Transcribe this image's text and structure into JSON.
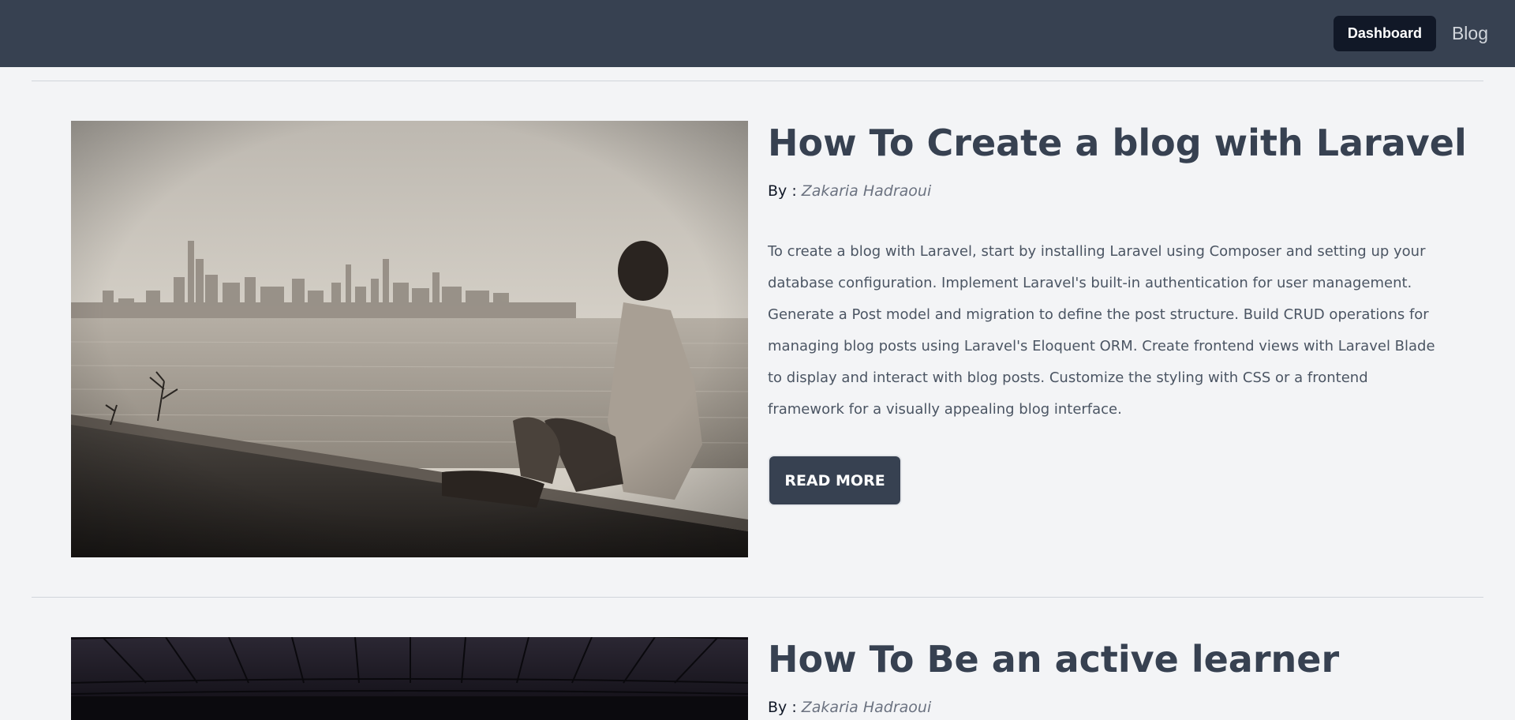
{
  "nav": {
    "dashboard_label": "Dashboard",
    "blog_label": "Blog"
  },
  "posts": [
    {
      "title": "How To Create a blog with Laravel",
      "by_prefix": "By : ",
      "author": "Zakaria Hadraoui",
      "excerpt": "To create a blog with Laravel, start by installing Laravel using Composer and setting up your database configuration. Implement Laravel's built-in authentication for user management. Generate a Post model and migration to define the post structure. Build CRUD operations for managing blog posts using Laravel's Eloquent ORM. Create frontend views with Laravel Blade to display and interact with blog posts. Customize the styling with CSS or a frontend framework for a visually appealing blog interface.",
      "read_more_label": "READ MORE"
    },
    {
      "title": "How To Be an active learner",
      "by_prefix": "By : ",
      "author": "Zakaria Hadraoui"
    }
  ],
  "colors": {
    "topbar": "#374151",
    "dashboard_button": "#111827",
    "page_background": "#f3f4f6",
    "title_text": "#374151"
  }
}
